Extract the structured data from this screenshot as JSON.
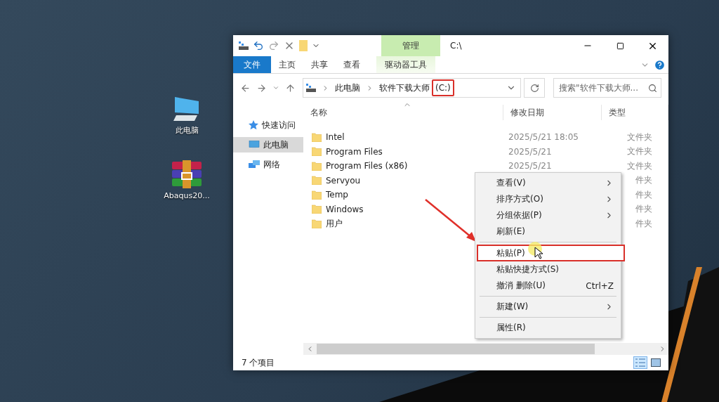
{
  "desktop_icons": [
    {
      "label": "此电脑",
      "kind": "computer"
    },
    {
      "label": "Abaqus20...",
      "kind": "archive"
    }
  ],
  "window": {
    "title": "C:\\",
    "context_group": "管理",
    "ribbon_tabs": [
      {
        "label": "文件",
        "kind": "file"
      },
      {
        "label": "主页",
        "kind": "normal"
      },
      {
        "label": "共享",
        "kind": "normal"
      },
      {
        "label": "查看",
        "kind": "normal"
      },
      {
        "label": "驱动器工具",
        "kind": "contextual"
      }
    ],
    "breadcrumbs": [
      {
        "label": "此电脑"
      },
      {
        "label": "软件下载大师",
        "drive": "(C:)",
        "drive_boxed": true
      }
    ],
    "search": {
      "placeholder": "搜索\"软件下载大师..."
    },
    "nav": [
      {
        "label": "快速访问",
        "kind": "star",
        "selected": false
      },
      {
        "label": "此电脑",
        "kind": "computer",
        "selected": true
      },
      {
        "label": "网络",
        "kind": "network",
        "selected": false
      }
    ],
    "columns": [
      "名称",
      "修改日期",
      "类型"
    ],
    "rows": [
      {
        "name": "Intel",
        "date": "2025/5/21 18:05",
        "type": "文件夹"
      },
      {
        "name": "Program Files",
        "date": "2025/5/21",
        "type": "文件夹"
      },
      {
        "name": "Program Files (x86)",
        "date": "2025/5/21",
        "type": "文件夹"
      },
      {
        "name": "Servyou",
        "type": "件夹"
      },
      {
        "name": "Temp",
        "type": "件夹"
      },
      {
        "name": "Windows",
        "type": "件夹"
      },
      {
        "name": "用户",
        "type": "件夹"
      }
    ],
    "status": "7 个项目",
    "context_menu": [
      {
        "kind": "submenu",
        "label": "查看(V)",
        "selected": false,
        "boxed": false
      },
      {
        "kind": "submenu",
        "label": "排序方式(O)",
        "selected": false,
        "boxed": false
      },
      {
        "kind": "submenu",
        "label": "分组依据(P)",
        "selected": false,
        "boxed": false
      },
      {
        "kind": "item",
        "label": "刷新(E)",
        "selected": false,
        "boxed": false
      },
      {
        "kind": "separator"
      },
      {
        "kind": "item",
        "label": "粘贴(P)",
        "selected": true,
        "boxed": true
      },
      {
        "kind": "item",
        "label": "粘贴快捷方式(S)",
        "selected": false,
        "boxed": false
      },
      {
        "kind": "item",
        "label": "撤消 删除(U)",
        "shortcut": "Ctrl+Z",
        "selected": false,
        "boxed": false
      },
      {
        "kind": "separator"
      },
      {
        "kind": "submenu",
        "label": "新建(W)",
        "selected": false,
        "boxed": false
      },
      {
        "kind": "separator"
      },
      {
        "kind": "item",
        "label": "属性(R)",
        "selected": false,
        "boxed": false
      }
    ]
  }
}
